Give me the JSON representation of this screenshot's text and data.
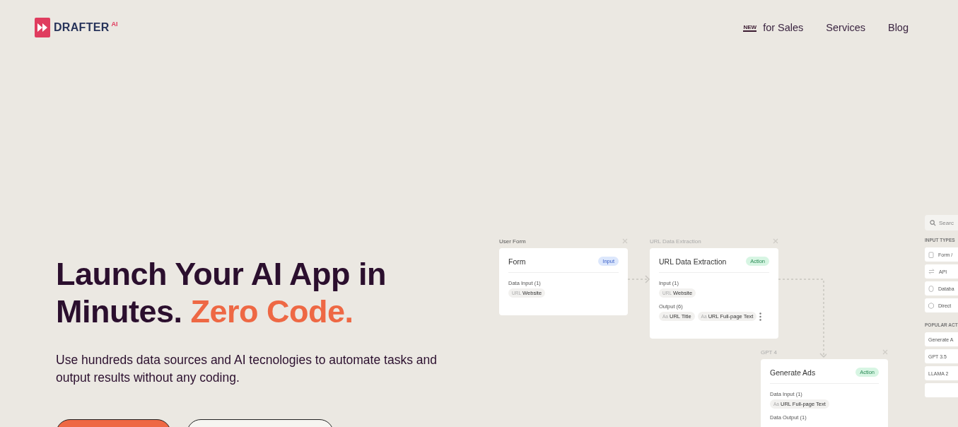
{
  "header": {
    "logo": {
      "text": "DRAFTER",
      "badge": "AI"
    },
    "nav": [
      {
        "badge": "NEW",
        "label": "for Sales"
      },
      {
        "label": "Services"
      },
      {
        "label": "Blog"
      }
    ]
  },
  "hero": {
    "title_start": "Launch Your AI App in Minutes.",
    "title_highlight": "Zero Code.",
    "subtitle": "Use hundreds data sources and AI tecnologies to automate tasks and output results without any coding.",
    "buttons": [
      {
        "kind": "primary"
      },
      {
        "kind": "secondary"
      }
    ]
  },
  "workflow": {
    "nodes": [
      {
        "kind": "input",
        "caption": "User Form",
        "title": "Form",
        "tag": "Input",
        "sections": [
          {
            "label": "Data Input (1)",
            "chips": [
              {
                "prefix": "URL",
                "text": "Website"
              }
            ]
          }
        ]
      },
      {
        "kind": "action",
        "caption": "URL Data Extraction",
        "title": "URL Data Extraction",
        "tag": "Action",
        "sections": [
          {
            "label": "Input (1)",
            "chips": [
              {
                "prefix": "URL",
                "text": "Website"
              }
            ]
          },
          {
            "label": "Output (6)",
            "chips": [
              {
                "prefix": "Aa",
                "text": "URL Title"
              },
              {
                "prefix": "Aa",
                "text": "URL Full-page Text"
              }
            ]
          }
        ]
      },
      {
        "kind": "action",
        "caption": "GPT 4",
        "title": "Generate Ads",
        "tag": "Action",
        "sections": [
          {
            "label": "Data Input (1)",
            "chips": [
              {
                "prefix": "Aa",
                "text": "URL Full-page Text"
              }
            ]
          },
          {
            "label": "Data Output (1)"
          }
        ]
      }
    ],
    "sidebar": {
      "search_placeholder": "Searc",
      "groups": [
        {
          "heading": "INPUT TYPES",
          "items": [
            {
              "label": "Form /"
            },
            {
              "label": "API"
            },
            {
              "label": "Databa"
            },
            {
              "label": "Direct"
            }
          ]
        },
        {
          "heading": "POPULAR ACT",
          "items": [
            {
              "label": "Generate A"
            },
            {
              "label": "GPT 3.5"
            },
            {
              "label": "LLAMA 2"
            }
          ]
        }
      ]
    }
  }
}
